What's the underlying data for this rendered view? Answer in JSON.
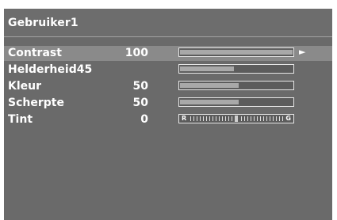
{
  "menu": {
    "title": "Gebruiker1",
    "selected_arrow": "►",
    "items": [
      {
        "label": "Contrast",
        "value": "100",
        "level": 1.0
      },
      {
        "label": "Helderheid45",
        "value": "",
        "level": 0.48
      },
      {
        "label": "Kleur",
        "value": "50",
        "level": 0.52
      },
      {
        "label": "Scherpte",
        "value": "50",
        "level": 0.52
      }
    ],
    "tint": {
      "label": "Tint",
      "value": "0",
      "left_letter": "R",
      "right_letter": "G",
      "level": 0.5
    }
  }
}
